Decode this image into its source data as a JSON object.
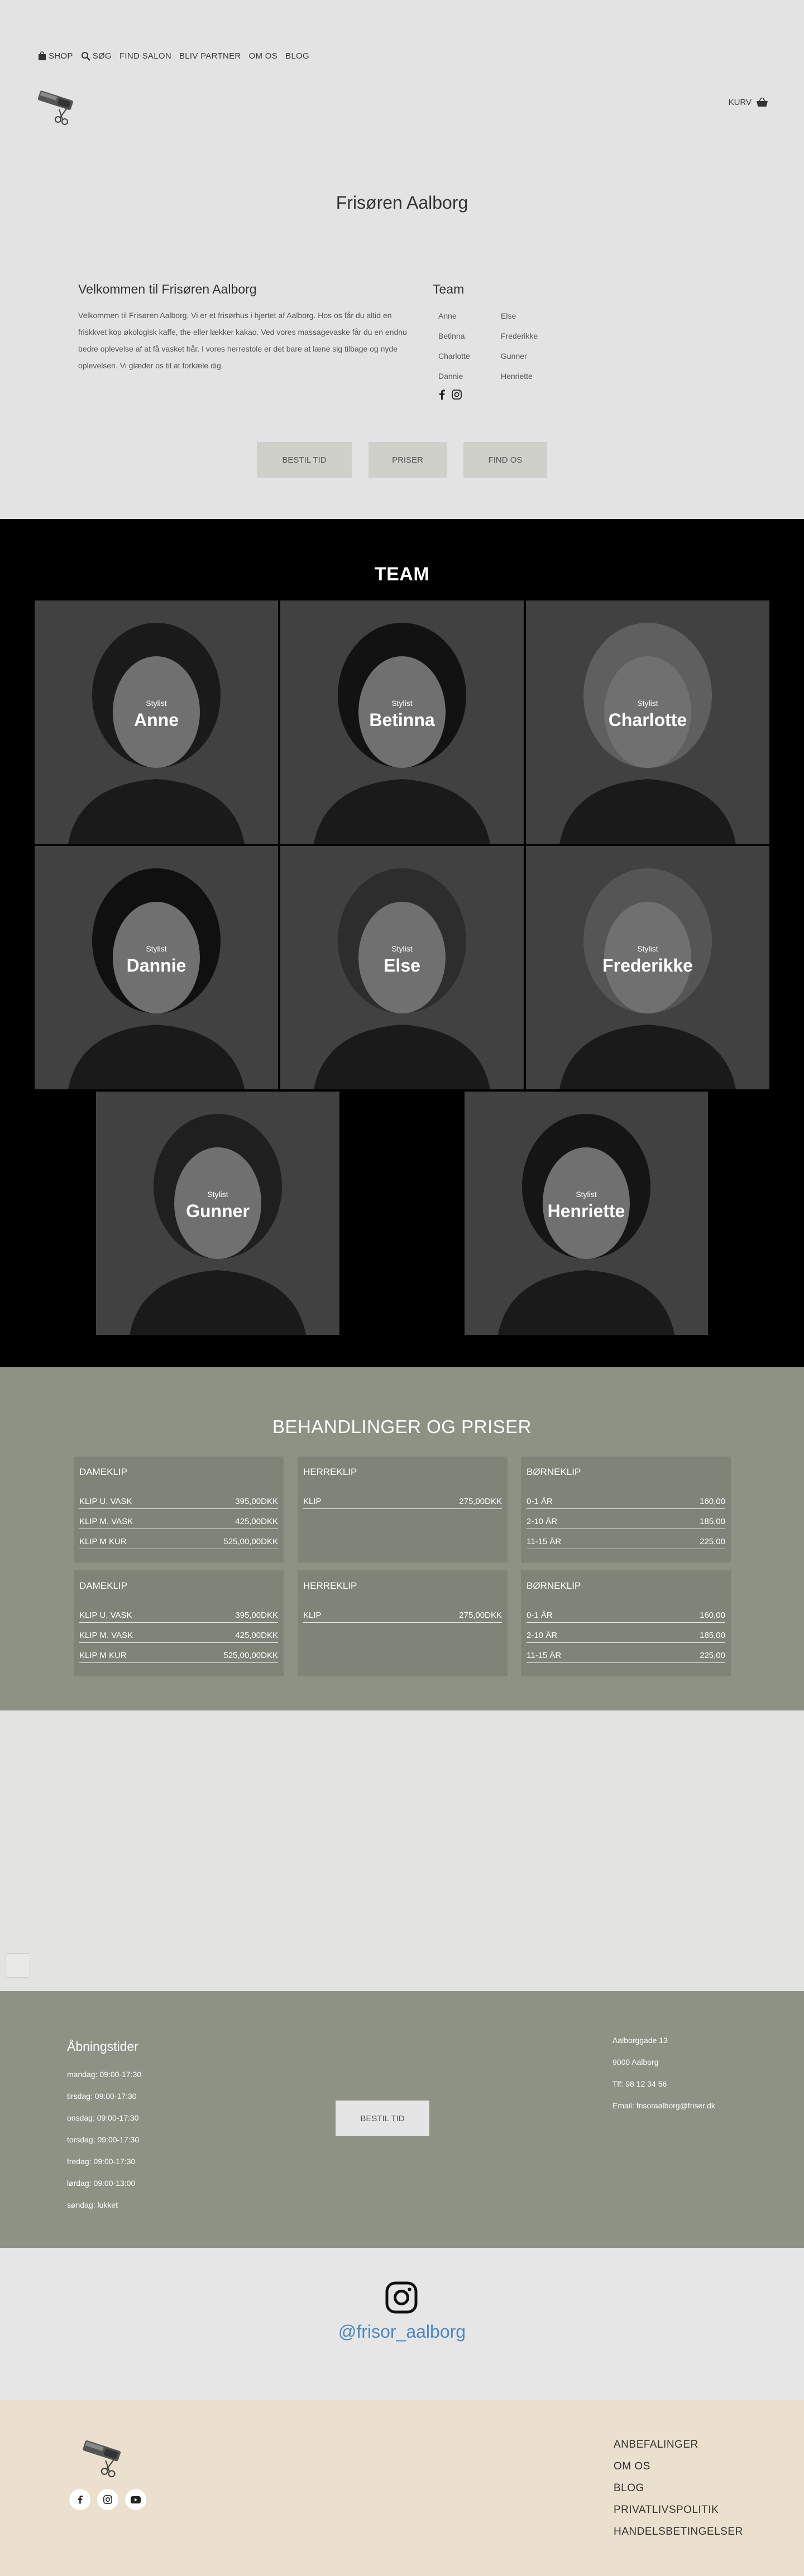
{
  "nav": {
    "shop": "SHOP",
    "search": "SØG",
    "find_salon": "FIND SALON",
    "become_partner": "BLIV PARTNER",
    "about": "OM OS",
    "blog": "BLOG",
    "cart": "KURV"
  },
  "hero": {
    "title": "Frisøren Aalborg",
    "welcome_heading": "Velkommen til Frisøren Aalborg",
    "welcome_text": "Velkommen til Frisøren Aalborg. Vi er et frisørhus i hjertet af Aalborg. Hos os får du altid en friskkvet kop økologisk kaffe, the eller lækker kakao. Ved vores massagevaske får du en endnu bedre oplevelse af at få vasket hår. I vores herrestole er det bare at læne sig tilbage og nyde oplevelsen. Vi glæder os til at forkæle dig.",
    "team_heading": "Team",
    "team": [
      "Anne",
      "Else",
      "Betinna",
      "Frederikke",
      "Charlotte",
      "Gunner",
      "Dannie",
      "Henriette"
    ]
  },
  "buttons": {
    "book": "BESTIL TID",
    "prices": "PRISER",
    "find": "FIND OS"
  },
  "team_section": {
    "title": "TEAM",
    "members": [
      {
        "role": "Stylist",
        "name": "Anne"
      },
      {
        "role": "Stylist",
        "name": "Betinna"
      },
      {
        "role": "Stylist",
        "name": "Charlotte"
      },
      {
        "role": "Stylist",
        "name": "Dannie"
      },
      {
        "role": "Stylist",
        "name": "Else"
      },
      {
        "role": "Stylist",
        "name": "Frederikke"
      },
      {
        "role": "Stylist",
        "name": "Gunner"
      },
      {
        "role": "Stylist",
        "name": "Henriette"
      }
    ]
  },
  "prices": {
    "title": "BEHANDLINGER OG PRISER",
    "groups": [
      {
        "title": "DAMEKLIP",
        "rows": [
          {
            "name": "KLIP U. VASK",
            "price": "395,00DKK"
          },
          {
            "name": "KLIP M. VASK",
            "price": "425,00DKK"
          },
          {
            "name": "KLIP M KUR",
            "price": "525,00,00DKK"
          }
        ]
      },
      {
        "title": "HERREKLIP",
        "rows": [
          {
            "name": "KLIP",
            "price": "275,00DKK"
          }
        ]
      },
      {
        "title": "BØRNEKLIP",
        "rows": [
          {
            "name": "0-1 ÅR",
            "price": "160,00"
          },
          {
            "name": "2-10 ÅR",
            "price": "185,00"
          },
          {
            "name": "11-15 ÅR",
            "price": "225,00"
          }
        ]
      },
      {
        "title": "DAMEKLIP",
        "rows": [
          {
            "name": "KLIP U. VASK",
            "price": "395,00DKK"
          },
          {
            "name": "KLIP M. VASK",
            "price": "425,00DKK"
          },
          {
            "name": "KLIP M KUR",
            "price": "525,00,00DKK"
          }
        ]
      },
      {
        "title": "HERREKLIP",
        "rows": [
          {
            "name": "KLIP",
            "price": "275,00DKK"
          }
        ]
      },
      {
        "title": "BØRNEKLIP",
        "rows": [
          {
            "name": "0-1 ÅR",
            "price": "160,00"
          },
          {
            "name": "2-10 ÅR",
            "price": "185,00"
          },
          {
            "name": "11-15 ÅR",
            "price": "225,00"
          }
        ]
      }
    ]
  },
  "footer": {
    "hours_title": "Åbningstider",
    "hours": [
      "mandag: 09:00-17:30",
      "tirsdag: 09:00-17:30",
      "onsdag: 09:00-17:30",
      "torsdag: 09:00-17:30",
      "fredag: 09:00-17:30",
      "lørdag: 09:00-13:00",
      "søndag: lukket"
    ],
    "book": "BESTIL TID",
    "address": [
      "Aalborggade 13",
      "9000 Aalborg",
      "Tlf: 98 12 34 56",
      "Email: frisoraalborg@friser.dk"
    ]
  },
  "instagram": {
    "handle": "@frisor_aalborg"
  },
  "bottom": {
    "links": [
      "ANBEFALINGER",
      "OM OS",
      "BLOG",
      "PRIVATLIVSPOLITIK",
      "HANDELSBETINGELSER"
    ]
  },
  "colors": {
    "sage": "#8d9285",
    "box": "#7f8478",
    "beige": "#ebdfcd",
    "link_blue": "#4b87c2"
  }
}
